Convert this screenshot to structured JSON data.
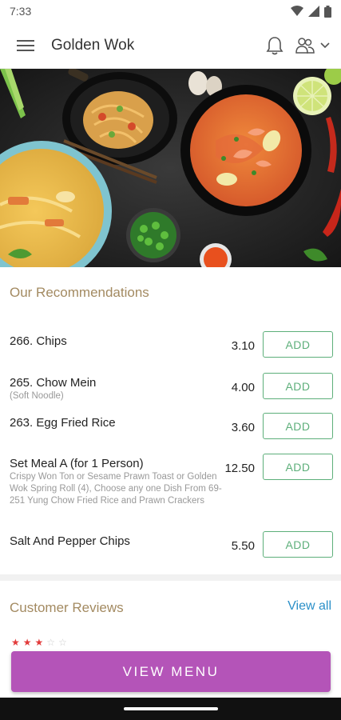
{
  "status_bar": {
    "time": "7:33"
  },
  "header": {
    "title": "Golden Wok"
  },
  "recommendations": {
    "title": "Our Recommendations",
    "items": [
      {
        "name": "266. Chips",
        "sub": "",
        "price": "3.10",
        "button": "ADD"
      },
      {
        "name": "265. Chow Mein",
        "sub": "(Soft Noodle)",
        "price": "4.00",
        "button": "ADD"
      },
      {
        "name": "263. Egg Fried Rice",
        "sub": "",
        "price": "3.60",
        "button": "ADD"
      },
      {
        "name": "Set Meal A (for 1 Person)",
        "sub": "Crispy Won Ton or Sesame Prawn Toast or Golden Wok Spring Roll (4), Choose any one Dish From 69-251 Yung Chow Fried Rice and Prawn Crackers",
        "price": "12.50",
        "button": "ADD"
      },
      {
        "name": "Salt And Pepper Chips",
        "sub": "",
        "price": "5.50",
        "button": "ADD"
      }
    ]
  },
  "reviews": {
    "title": "Customer Reviews",
    "view_all": "View all",
    "rating": 3,
    "max_rating": 5
  },
  "cta": {
    "label": "VIEW MENU"
  },
  "colors": {
    "accent": "#b454b8",
    "add_green": "#5daf7a",
    "section_gold": "#a38a61",
    "link_blue": "#2a8fc8"
  }
}
